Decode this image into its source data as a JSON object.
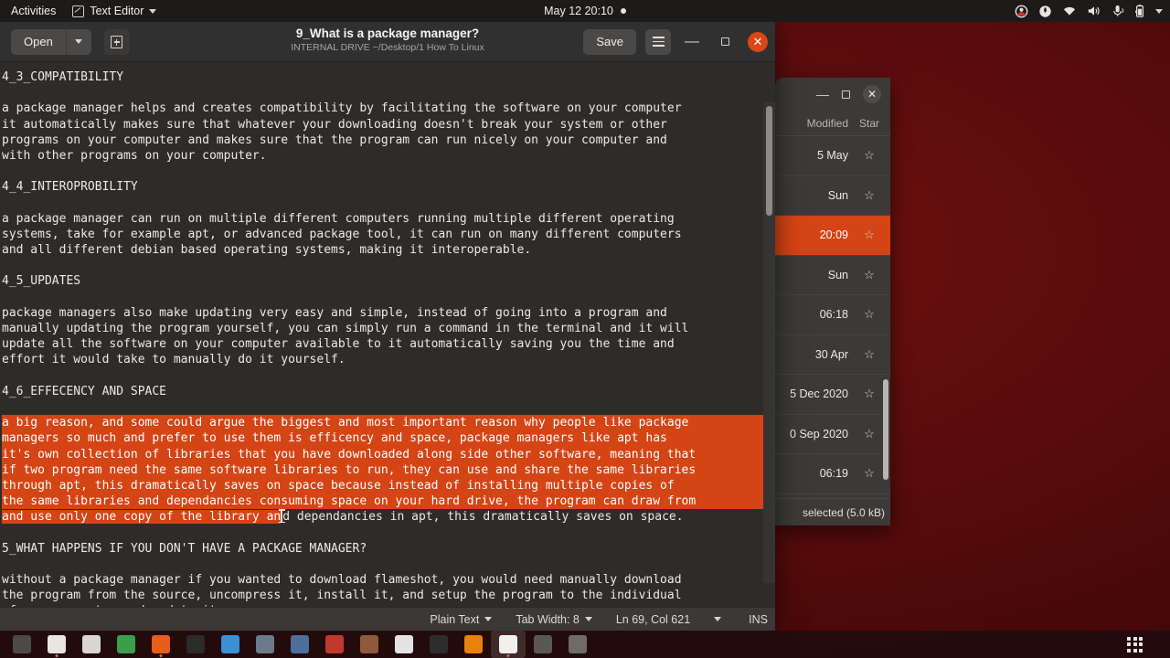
{
  "topbar": {
    "activities": "Activities",
    "app_name": "Text Editor",
    "clock": "May 12  20:10",
    "tray_icons": [
      "recording-indicator-icon",
      "shield-icon",
      "wifi-icon",
      "volume-icon",
      "microphone-icon",
      "battery-icon",
      "chevron-down-icon"
    ]
  },
  "editor": {
    "open_label": "Open",
    "save_label": "Save",
    "title": "9_What is a package manager?",
    "subtitle": "INTERNAL DRIVE ~/Desktop/1 How To Linux",
    "status": {
      "language": "Plain Text",
      "tab_width": "Tab Width: 8",
      "position": "Ln 69, Col 621",
      "mode": "INS"
    },
    "document": {
      "heading_43": "4_3_COMPATIBILITY",
      "para_43": [
        "a package manager helps and creates compatibility by facilitating the software on your computer",
        "it automatically makes sure that whatever your downloading doesn't break your system or other",
        "programs on your computer and makes sure that the program can run nicely on your computer and",
        "with other programs on your computer."
      ],
      "heading_44": "4_4_INTEROPROBILITY",
      "para_44": [
        "a package manager can run on multiple different computers running multiple different operating",
        "systems, take for example apt, or advanced package tool, it can run on many different computers",
        "and all different debian based operating systems, making it interoperable."
      ],
      "heading_45": "4_5_UPDATES",
      "para_45": [
        "package managers also make updating very easy and simple, instead of going into a program and",
        "manually updating the program yourself, you can simply run a command in the terminal and it will",
        "update all the software on your computer available to it automatically saving you the time and",
        "effort it would take to manually do it yourself."
      ],
      "heading_46": "4_6_EFFECENCY AND SPACE",
      "para_46_selected": [
        "a big reason, and some could argue the biggest and most important reason why people like package",
        "managers so much and prefer to use them is efficency and space, package managers like apt has",
        "it's own collection of libraries that you have downloaded along side other software, meaning that",
        "if two program need the same software libraries to run, they can use and share the same libraries",
        "through apt, this dramatically saves on space because instead of installing multiple copies of",
        "the same libraries and dependancies consuming space on your hard drive, the program can draw from"
      ],
      "para_46_last_selected": "and use only one copy of the library an",
      "para_46_last_unselected": "d dependancies in apt, this dramatically saves on space.",
      "heading_5": "5_WHAT HAPPENS IF YOU DON'T HAVE A PACKAGE MANAGER?",
      "para_5": [
        "without a package manager if you wanted to download flameshot, you would need manually download",
        "the program from the source, uncompress it, install it, and setup the program to the individual",
        "of your computer and update it."
      ]
    }
  },
  "filemanager": {
    "columns": [
      "Modified",
      "Star"
    ],
    "rows": [
      {
        "modified": "5 May",
        "star": "☆",
        "selected": false
      },
      {
        "modified": "Sun",
        "star": "☆",
        "selected": false
      },
      {
        "modified": "20:09",
        "star": "☆",
        "selected": true
      },
      {
        "modified": "Sun",
        "star": "☆",
        "selected": false
      },
      {
        "modified": "06:18",
        "star": "☆",
        "selected": false
      },
      {
        "modified": "30 Apr",
        "star": "☆",
        "selected": false
      },
      {
        "modified": "5 Dec 2020",
        "star": "☆",
        "selected": false
      },
      {
        "modified": "0 Sep 2020",
        "star": "☆",
        "selected": false
      },
      {
        "modified": "06:19",
        "star": "☆",
        "selected": false
      }
    ],
    "status": "selected (5.0 kB)"
  },
  "dock": {
    "items": [
      {
        "name": "terminal",
        "color": "#4c4a48",
        "running": false
      },
      {
        "name": "files",
        "color": "#e8e6e1",
        "running": true
      },
      {
        "name": "software-store",
        "color": "#d9d6d1",
        "running": false
      },
      {
        "name": "chrome",
        "color": "#3b9e4b",
        "running": false
      },
      {
        "name": "firefox",
        "color": "#e85d1c",
        "running": true
      },
      {
        "name": "tor-browser",
        "color": "#2b2b2b",
        "running": false
      },
      {
        "name": "text-document",
        "color": "#3d8fd6",
        "running": false
      },
      {
        "name": "image-viewer",
        "color": "#6b7b8c",
        "running": false
      },
      {
        "name": "gimp",
        "color": "#4e6f9e",
        "running": false
      },
      {
        "name": "flameshot",
        "color": "#c0392b",
        "running": false
      },
      {
        "name": "multimedia",
        "color": "#8e5a3b",
        "running": false
      },
      {
        "name": "vivaldi",
        "color": "#e3e3e3",
        "running": false
      },
      {
        "name": "music-player",
        "color": "#2d2d2d",
        "running": false
      },
      {
        "name": "vlc",
        "color": "#e8820c",
        "running": false
      },
      {
        "name": "text-editor",
        "color": "#f2f0ee",
        "running": true,
        "active": true
      },
      {
        "name": "settings",
        "color": "#5a5855",
        "running": false
      },
      {
        "name": "help",
        "color": "#6e6b68",
        "running": false
      }
    ],
    "show_apps": "show-applications"
  },
  "colors": {
    "selection": "#d54415",
    "desktop": "#5c0d0d",
    "panel": "#1c1b1a"
  }
}
